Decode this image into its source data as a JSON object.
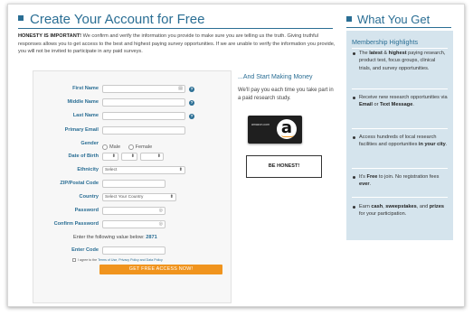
{
  "header": {
    "title": "Create Your Account for Free",
    "intro_bold": "HONESTY IS IMPORTANT!",
    "intro_text": " We confirm and verify the information you provide to make sure you are telling us the truth. Giving truthful responses allows you to get access to the best and highest paying survey opportunities. If we are unable to verify the information you provide, you will not be invited to participate in any paid surveys."
  },
  "form": {
    "first_name_label": "First Name",
    "middle_name_label": "Middle Name",
    "last_name_label": "Last Name",
    "primary_email_label": "Primary Email",
    "gender_label": "Gender",
    "gender_male": "Male",
    "gender_female": "Female",
    "dob_label": "Date of Birth",
    "ethnicity_label": "Ethnicity",
    "ethnicity_value": "Select",
    "zip_label": "ZIP/Postal Code",
    "country_label": "Country",
    "country_value": "Select Your Country",
    "password_label": "Password",
    "confirm_password_label": "Confirm Password",
    "enter_value_text": "Enter the following value below:",
    "enter_value_code": "2871",
    "enter_code_label": "Enter Code",
    "agree_prefix": "I agree to the",
    "agree_links": "Terms of Use, Privacy Policy and Data Policy",
    "submit_label": "GET FREE ACCESS NOW!"
  },
  "promo": {
    "title": "...And Start Making Money",
    "text": "We'll pay you each time you take part in a paid research study.",
    "card_text": "amazon.com",
    "card_letter": "a",
    "honest_button": "BE HONEST!"
  },
  "sidebar": {
    "title": "What You Get",
    "heading": "Membership Highlights",
    "items": [
      {
        "pre": "The ",
        "b1": "latest",
        "mid": " & ",
        "b2": "highest",
        "post": " paying research, product test, focus groups, clinical trials, and survey opportunities."
      },
      {
        "pre": "Receive new research opportunities via ",
        "b1": "Email",
        "mid": " or ",
        "b2": "Text Message",
        "post": "."
      },
      {
        "pre": "Access hundreds of local research facilities and opportunities ",
        "b1": "in your city",
        "mid": "",
        "b2": "",
        "post": "."
      },
      {
        "pre": "It's ",
        "b1": "Free",
        "mid": " to join. No registration fees ",
        "b2": "ever",
        "post": "."
      },
      {
        "pre": "Earn ",
        "b1": "cash",
        "mid": ", ",
        "b2": "sweepstakes",
        "post": ", and "
      },
      {
        "pre": "",
        "b1": "prizes",
        "mid": "",
        "b2": "",
        "post": " for your participation."
      }
    ]
  },
  "colors": {
    "accent": "#2a6e94",
    "cta": "#f0941e",
    "sidebar_bg": "#d5e4ed"
  }
}
